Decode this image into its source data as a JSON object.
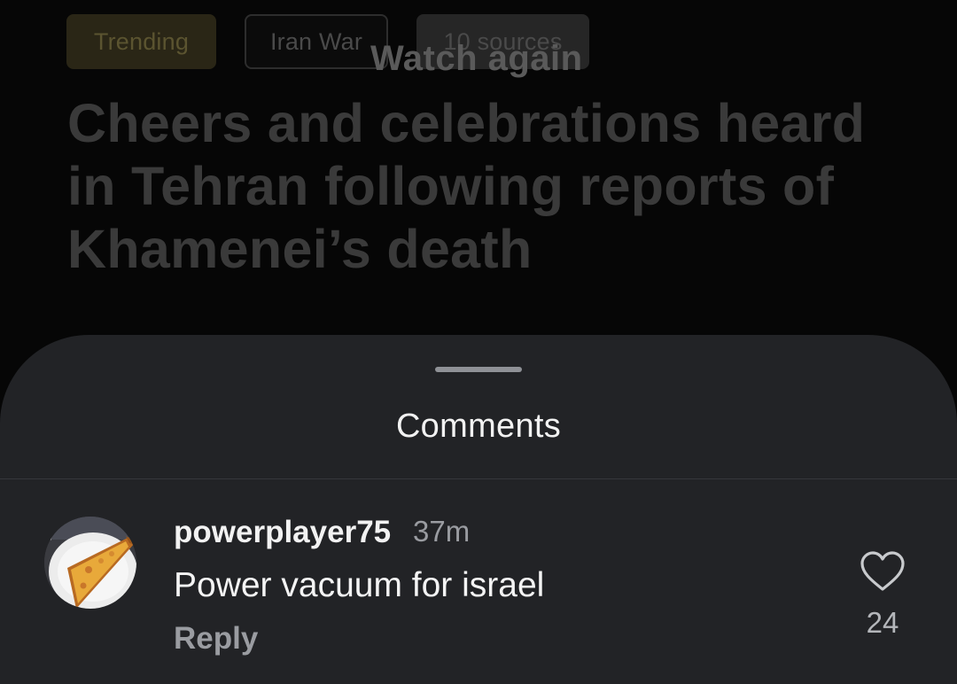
{
  "article": {
    "tags": [
      "Trending",
      "Iran War",
      "10 sources"
    ],
    "overlay_label": "Watch again",
    "headline": "Cheers and celebrations heard in Tehran following reports of Khamenei’s death"
  },
  "comments_sheet": {
    "title": "Comments",
    "comments": [
      {
        "username": "powerplayer75",
        "time_ago": "37m",
        "text": "Power vacuum for israel",
        "reply_label": "Reply",
        "like_count": "24",
        "avatar_icon": "pizza-slice-avatar",
        "like_icon": "heart-icon"
      }
    ]
  },
  "colors": {
    "sheet_background": "#222326",
    "page_background": "#060606",
    "secondary_text": "#9a9ca1"
  }
}
